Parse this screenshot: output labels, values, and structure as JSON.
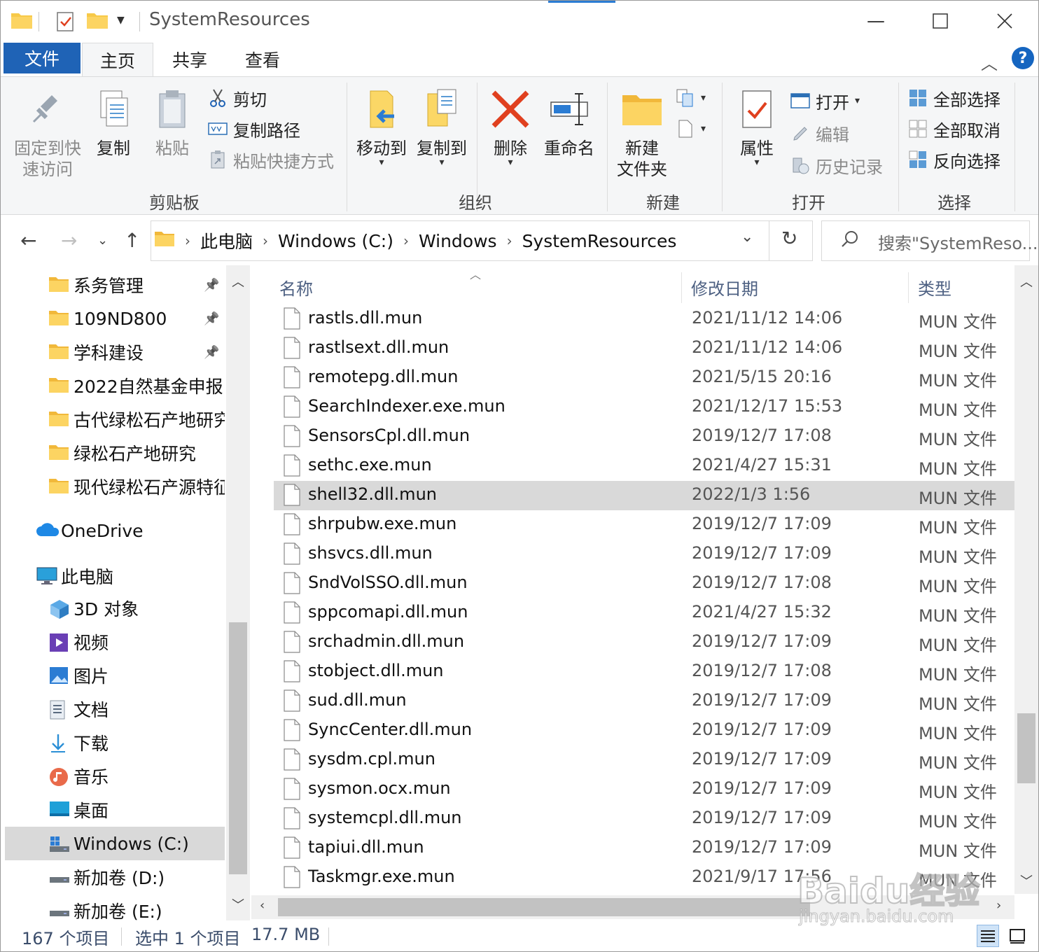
{
  "window": {
    "title": "SystemResources"
  },
  "ribbon_tabs": [
    "文件",
    "主页",
    "共享",
    "查看"
  ],
  "ribbon": {
    "clipboard": {
      "pin_label": "固定到快速访问",
      "pin_line1": "固定到快",
      "pin_line2": "速访问",
      "copy": "复制",
      "paste": "粘贴",
      "cut": "剪切",
      "copy_path": "复制路径",
      "paste_shortcut": "粘贴快捷方式",
      "group": "剪贴板"
    },
    "organize": {
      "move_to": "移动到",
      "copy_to": "复制到",
      "delete": "删除",
      "rename": "重命名",
      "group": "组织"
    },
    "new": {
      "new_folder_line1": "新建",
      "new_folder_line2": "文件夹",
      "group": "新建"
    },
    "open": {
      "properties": "属性",
      "open": "打开",
      "edit": "编辑",
      "history": "历史记录",
      "group": "打开"
    },
    "select": {
      "select_all": "全部选择",
      "select_none": "全部取消",
      "invert": "反向选择",
      "group": "选择"
    }
  },
  "address": {
    "breadcrumbs": [
      "此电脑",
      "Windows (C:)",
      "Windows",
      "SystemResources"
    ],
    "search_placeholder": "搜索\"SystemReso..."
  },
  "nav_pane": {
    "quick_access": [
      {
        "label": "系务管理",
        "pinned": true
      },
      {
        "label": "109ND800",
        "pinned": true
      },
      {
        "label": "学科建设",
        "pinned": true
      },
      {
        "label": "2022自然基金申报",
        "pinned": false
      },
      {
        "label": "古代绿松石产地研究",
        "pinned": false
      },
      {
        "label": "绿松石产地研究",
        "pinned": false
      },
      {
        "label": "现代绿松石产源特征",
        "pinned": false
      }
    ],
    "onedrive": "OneDrive",
    "this_pc": "此电脑",
    "pc_items": [
      {
        "label": "3D 对象",
        "icon": "3d-objects-icon"
      },
      {
        "label": "视频",
        "icon": "videos-icon"
      },
      {
        "label": "图片",
        "icon": "pictures-icon"
      },
      {
        "label": "文档",
        "icon": "documents-icon"
      },
      {
        "label": "下载",
        "icon": "downloads-icon"
      },
      {
        "label": "音乐",
        "icon": "music-icon"
      },
      {
        "label": "桌面",
        "icon": "desktop-icon"
      },
      {
        "label": "Windows (C:)",
        "icon": "drive-c-icon",
        "selected": true
      },
      {
        "label": "新加卷 (D:)",
        "icon": "drive-icon"
      },
      {
        "label": "新加卷 (E:)",
        "icon": "drive-icon"
      }
    ]
  },
  "file_list": {
    "columns": [
      "名称",
      "修改日期",
      "类型"
    ],
    "rows": [
      {
        "name": "rastls.dll.mun",
        "date": "2021/11/12 14:06",
        "type": "MUN 文件"
      },
      {
        "name": "rastlsext.dll.mun",
        "date": "2021/11/12 14:06",
        "type": "MUN 文件"
      },
      {
        "name": "remotepg.dll.mun",
        "date": "2021/5/15 20:16",
        "type": "MUN 文件"
      },
      {
        "name": "SearchIndexer.exe.mun",
        "date": "2021/12/17 15:53",
        "type": "MUN 文件"
      },
      {
        "name": "SensorsCpl.dll.mun",
        "date": "2019/12/7 17:08",
        "type": "MUN 文件"
      },
      {
        "name": "sethc.exe.mun",
        "date": "2021/4/27 15:31",
        "type": "MUN 文件"
      },
      {
        "name": "shell32.dll.mun",
        "date": "2022/1/3 1:56",
        "type": "MUN 文件",
        "selected": true
      },
      {
        "name": "shrpubw.exe.mun",
        "date": "2019/12/7 17:09",
        "type": "MUN 文件"
      },
      {
        "name": "shsvcs.dll.mun",
        "date": "2019/12/7 17:09",
        "type": "MUN 文件"
      },
      {
        "name": "SndVolSSO.dll.mun",
        "date": "2019/12/7 17:08",
        "type": "MUN 文件"
      },
      {
        "name": "sppcomapi.dll.mun",
        "date": "2021/4/27 15:32",
        "type": "MUN 文件"
      },
      {
        "name": "srchadmin.dll.mun",
        "date": "2019/12/7 17:09",
        "type": "MUN 文件"
      },
      {
        "name": "stobject.dll.mun",
        "date": "2019/12/7 17:08",
        "type": "MUN 文件"
      },
      {
        "name": "sud.dll.mun",
        "date": "2019/12/7 17:09",
        "type": "MUN 文件"
      },
      {
        "name": "SyncCenter.dll.mun",
        "date": "2019/12/7 17:09",
        "type": "MUN 文件"
      },
      {
        "name": "sysdm.cpl.mun",
        "date": "2019/12/7 17:09",
        "type": "MUN 文件"
      },
      {
        "name": "sysmon.ocx.mun",
        "date": "2019/12/7 17:09",
        "type": "MUN 文件"
      },
      {
        "name": "systemcpl.dll.mun",
        "date": "2019/12/7 17:09",
        "type": "MUN 文件"
      },
      {
        "name": "tapiui.dll.mun",
        "date": "2019/12/7 17:09",
        "type": "MUN 文件"
      },
      {
        "name": "Taskmgr.exe.mun",
        "date": "2021/9/17 17:56",
        "type": "MUN 文件"
      }
    ]
  },
  "status": {
    "count": "167 个项目",
    "selection": "选中 1 个项目",
    "size": "17.7 MB"
  },
  "watermark": {
    "brand": "Baidu经验",
    "url": "jingyan.baidu.com"
  },
  "colors": {
    "accent": "#1f63b6",
    "folder": "#f7c948",
    "selection": "#d9d9d9",
    "delete_red": "#e0401f"
  }
}
